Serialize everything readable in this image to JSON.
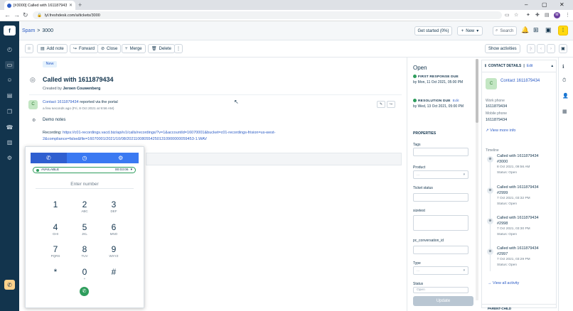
{
  "browser": {
    "tab_title": "[#3000] Called with 1611879434",
    "url": "lyl.freshdesk.com/a/tickets/3000",
    "profile_initial": "M"
  },
  "header": {
    "breadcrumb_parent": "Spam",
    "breadcrumb_current": "3000",
    "get_started_label": "Get started (0%)",
    "new_label": "New",
    "search_placeholder": "Search"
  },
  "toolbar": {
    "add_note": "Add note",
    "forward": "Forward",
    "close": "Close",
    "merge": "Merge",
    "delete": "Delete",
    "show_activities": "Show activities"
  },
  "ticket": {
    "badge": "New",
    "title": "Called with 1611879434",
    "created_prefix": "Created by",
    "created_by": "Jeroen Couwenberg",
    "contact_link": "Contact 1611879434",
    "reported_text": "reported via the portal",
    "time_text": "a few seconds ago (Fri, 8 Oct 2021 at 9:56 AM)",
    "demo_notes": "Demo notes",
    "recording_label": "Recording:",
    "recording_url": "https://c01-recordings.vacd.biz/api/v1/calls/recordings/?v=1&accountId=16070001&bucket=c01-recordings-frision=us-west-2&compliance=false&file=16070001/2021/10/08/2021100805542501310900000059453-1.WAV"
  },
  "dialer": {
    "status": "AVAILABLE",
    "timer": "00:03:06",
    "placeholder": "Enter number",
    "keys": [
      {
        "d": "1",
        "s": ""
      },
      {
        "d": "2",
        "s": "ABC"
      },
      {
        "d": "3",
        "s": "DEF"
      },
      {
        "d": "4",
        "s": "GHI"
      },
      {
        "d": "5",
        "s": "JKL"
      },
      {
        "d": "6",
        "s": "MNO"
      },
      {
        "d": "7",
        "s": "PQRS"
      },
      {
        "d": "8",
        "s": "TUV"
      },
      {
        "d": "9",
        "s": "WXYZ"
      },
      {
        "d": "*",
        "s": ""
      },
      {
        "d": "0",
        "s": "+"
      },
      {
        "d": "#",
        "s": ""
      }
    ]
  },
  "properties": {
    "status": "Open",
    "first_response_label": "FIRST RESPONSE DUE",
    "first_response_value": "by Mon, 11 Oct 2021, 05:00 PM",
    "resolution_label": "RESOLUTION DUE",
    "resolution_edit": "Edit",
    "resolution_value": "by Wed, 13 Oct 2021, 05:00 PM",
    "heading": "PROPERTIES",
    "tags_label": "Tags",
    "product_label": "Product",
    "product_value": "...",
    "ticket_status_label": "Ticket status",
    "sizetest_label": "sizetest",
    "pc_conv_label": "pc_conversation_id",
    "type_label": "Type",
    "type_value": "...",
    "status_label": "Status",
    "status_value": "Open",
    "update_label": "Update"
  },
  "contact": {
    "header": "CONTACT DETAILS",
    "edit": "Edit",
    "avatar": "C",
    "name": "Contact 1611879434",
    "work_phone_label": "Work phone",
    "work_phone": "1611879434",
    "mobile_label": "Mobile phone",
    "mobile": "1611879434",
    "view_more": "View more info",
    "timeline_label": "Timeline",
    "timeline": [
      {
        "title": "Called with 1611879434",
        "id": "#3000",
        "date": "8 Oct 2021, 09:56 AM",
        "status": "Status: Open"
      },
      {
        "title": "Called with 1611879434",
        "id": "#2999",
        "date": "7 Oct 2021, 03:32 PM",
        "status": "Status: Open"
      },
      {
        "title": "Called with 1611879434",
        "id": "#2998",
        "date": "7 Oct 2021, 03:30 PM",
        "status": "Status: Open"
      },
      {
        "title": "Called with 1611879434",
        "id": "#2997",
        "date": "7 Oct 2021, 03:29 PM",
        "status": "Status: Open"
      }
    ],
    "view_all": "View all activity",
    "parent_child": "PARENT-CHILD"
  }
}
